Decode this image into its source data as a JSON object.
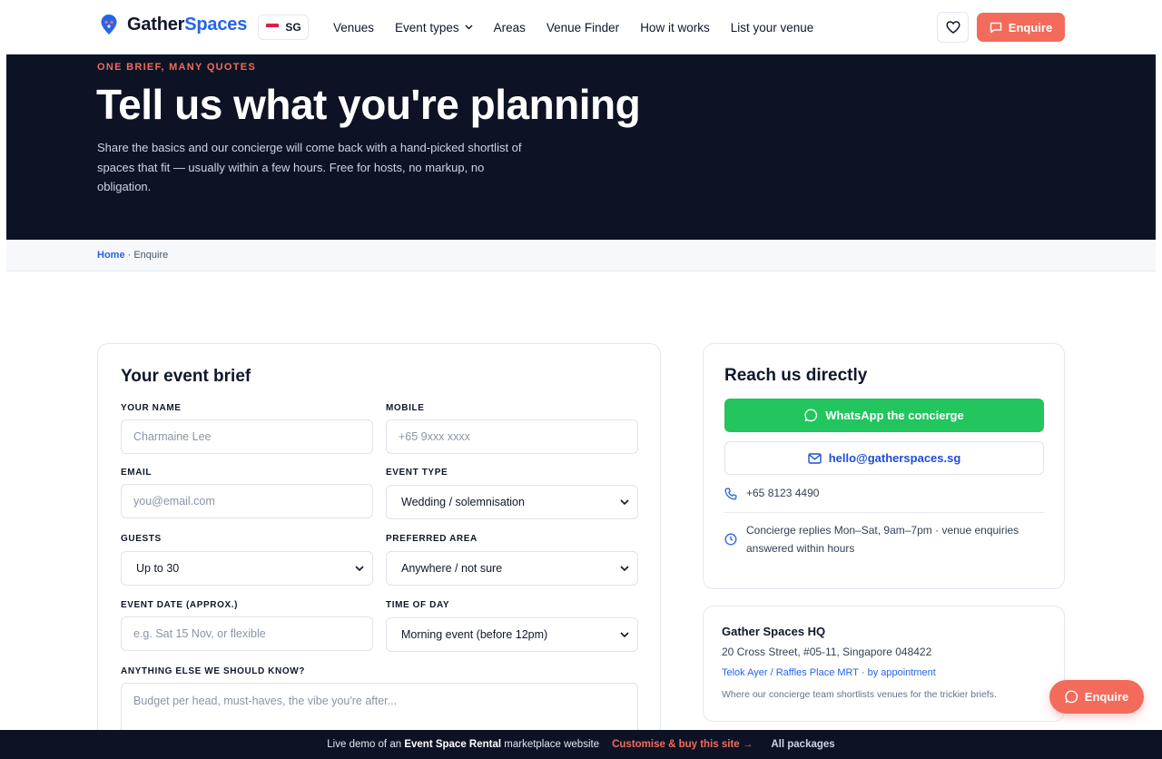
{
  "header": {
    "logo_part1": "Gather",
    "logo_part2": "Spaces",
    "country_code": "SG",
    "nav": [
      "Venues",
      "Event types",
      "Areas",
      "Venue Finder",
      "How it works",
      "List your venue"
    ],
    "enquire_label": "Enquire"
  },
  "hero": {
    "eyebrow": "ONE BRIEF, MANY QUOTES",
    "title": "Tell us what you're planning",
    "subtitle": "Share the basics and our concierge will come back with a hand-picked shortlist of spaces that fit — usually within a few hours. Free for hosts, no markup, no obligation."
  },
  "breadcrumb": {
    "home": "Home",
    "separator": " · ",
    "current": "Enquire"
  },
  "form": {
    "title": "Your event brief",
    "name_label": "YOUR NAME",
    "name_placeholder": "Charmaine Lee",
    "mobile_label": "MOBILE",
    "mobile_placeholder": "+65 9xxx xxxx",
    "email_label": "EMAIL",
    "email_placeholder": "you@email.com",
    "event_type_label": "EVENT TYPE",
    "event_type_value": "Wedding / solemnisation",
    "guests_label": "GUESTS",
    "guests_value": "Up to 30",
    "area_label": "PREFERRED AREA",
    "area_value": "Anywhere / not sure",
    "date_label": "EVENT DATE (APPROX.)",
    "date_placeholder": "e.g. Sat 15 Nov, or flexible",
    "time_label": "TIME OF DAY",
    "time_value": "Morning event (before 12pm)",
    "notes_label": "ANYTHING ELSE WE SHOULD KNOW?",
    "notes_placeholder": "Budget per head, must-haves, the vibe you're after..."
  },
  "reach": {
    "title": "Reach us directly",
    "whatsapp_label": "WhatsApp the concierge",
    "email_label": "hello@gatherspaces.sg",
    "phone": "+65 8123 4490",
    "hours": "Concierge replies Mon–Sat, 9am–7pm · venue enquiries answered within hours"
  },
  "hq": {
    "title": "Gather Spaces HQ",
    "address": "20 Cross Street, #05-11, Singapore 048422",
    "link": "Telok Ayer / Raffles Place MRT · by appointment",
    "note": "Where our concierge team shortlists venues for the trickier briefs."
  },
  "float_enquire_label": "Enquire",
  "demo_bar": {
    "prefix": "Live demo of an",
    "site_type": "Event Space Rental",
    "suffix": "marketplace website",
    "cta": "Customise & buy this site →",
    "packages": "All packages"
  },
  "colors": {
    "accent": "#f26b5b",
    "brand_blue": "#2563eb",
    "hero_bg": "#0d1324",
    "whatsapp": "#22c55e"
  }
}
